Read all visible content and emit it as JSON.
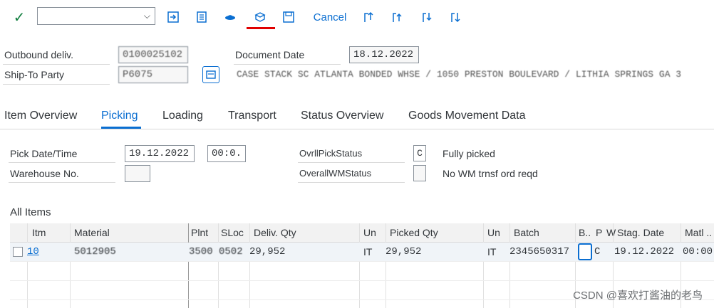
{
  "toolbar": {
    "check_glyph": "✓",
    "command_field_value": "",
    "chevron_glyph": "⌵",
    "cancel_label": "Cancel",
    "icons": [
      "enter-icon",
      "save-layout-icon",
      "hat-icon",
      "pick-icon",
      "save-icon",
      "first-page-icon",
      "previous-page-icon",
      "next-page-icon",
      "last-page-icon"
    ]
  },
  "header": {
    "outbound_label": "Outbound deliv.",
    "outbound_value": "0100025102",
    "doc_date_label": "Document Date",
    "doc_date_value": "18.12.2022",
    "ship_to_label": "Ship-To Party",
    "ship_to_value": "P6075",
    "ship_to_address": "CASE STACK SC ATLANTA BONDED WHSE / 1050 PRESTON BOULEVARD / LITHIA SPRINGS GA 3"
  },
  "tabs": [
    "Item Overview",
    "Picking",
    "Loading",
    "Transport",
    "Status Overview",
    "Goods Movement Data"
  ],
  "picking": {
    "pick_date_label": "Pick Date/Time",
    "pick_date_value": "19.12.2022",
    "pick_time_value": "00:0.",
    "warehouse_label": "Warehouse No.",
    "warehouse_value": "",
    "ovrl_pick_label": "OvrllPickStatus",
    "ovrl_pick_code": "C",
    "ovrl_pick_text": "Fully picked",
    "overall_wm_label": "OverallWMStatus",
    "overall_wm_code": "",
    "overall_wm_text": "No WM trnsf ord reqd"
  },
  "items": {
    "section_title": "All Items",
    "columns": [
      "Itm",
      "Material",
      "Plnt",
      "SLoc",
      "Deliv. Qty",
      "Un",
      "Picked Qty",
      "Un",
      "Batch",
      "B..",
      "P",
      "W",
      "Stag. Date",
      "Matl .."
    ],
    "rows": [
      {
        "itm": "10",
        "material": "5012905",
        "plnt": "3500",
        "sloc": "0502",
        "deliv_qty": "29,952",
        "un": "IT",
        "picked_qty": "29,952",
        "un2": "IT",
        "batch": "2345650317",
        "b": "",
        "p": "C",
        "w": "",
        "stag_date": "19.12.2022",
        "matl": "00:00"
      }
    ]
  },
  "watermark": "CSDN @喜欢打酱油的老鸟"
}
